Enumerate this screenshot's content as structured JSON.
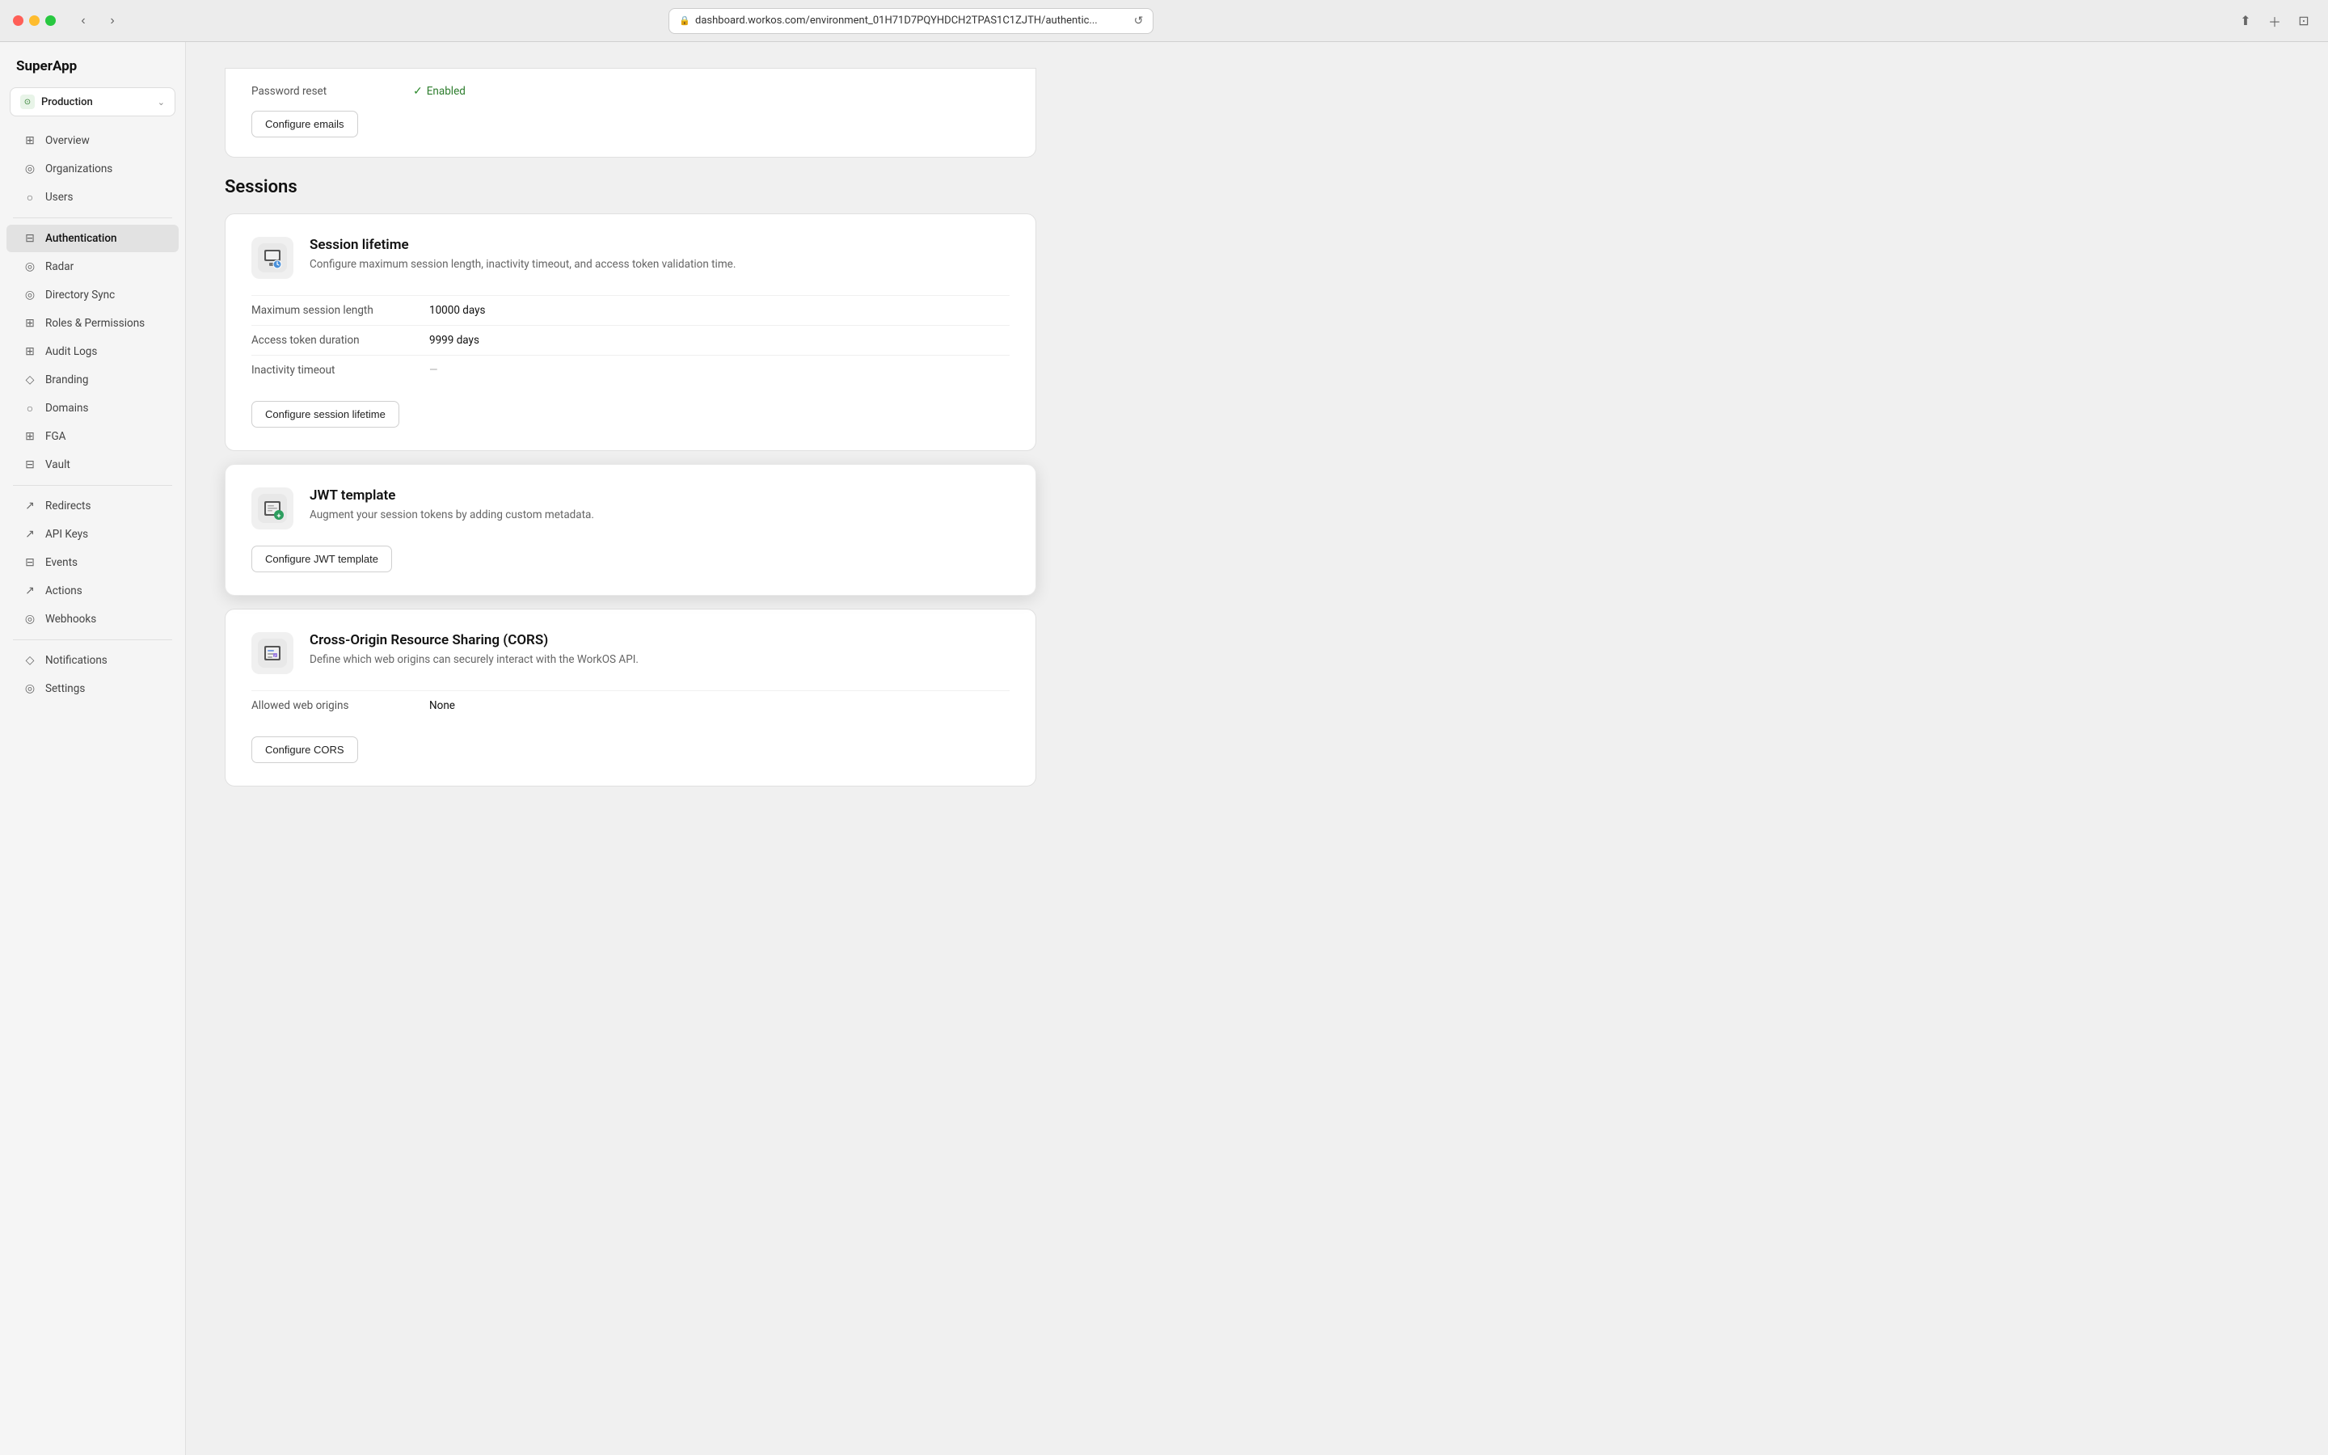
{
  "browser": {
    "url": "dashboard.workos.com/environment_01H71D7PQYHDCH2TPAS1C1ZJTH/authentic...",
    "back_label": "‹",
    "forward_label": "›"
  },
  "app": {
    "logo": "SuperApp"
  },
  "env_selector": {
    "label": "Production",
    "chevron": "⌄"
  },
  "sidebar": {
    "items": [
      {
        "id": "overview",
        "label": "Overview",
        "icon": "⊞"
      },
      {
        "id": "organizations",
        "label": "Organizations",
        "icon": "◎"
      },
      {
        "id": "users",
        "label": "Users",
        "icon": "○"
      },
      {
        "id": "authentication",
        "label": "Authentication",
        "icon": "⊟",
        "active": true
      },
      {
        "id": "radar",
        "label": "Radar",
        "icon": "◎"
      },
      {
        "id": "directory-sync",
        "label": "Directory Sync",
        "icon": "◎"
      },
      {
        "id": "roles-permissions",
        "label": "Roles & Permissions",
        "icon": "⊞"
      },
      {
        "id": "audit-logs",
        "label": "Audit Logs",
        "icon": "⊞"
      },
      {
        "id": "branding",
        "label": "Branding",
        "icon": "◇"
      },
      {
        "id": "domains",
        "label": "Domains",
        "icon": "○"
      },
      {
        "id": "fga",
        "label": "FGA",
        "icon": "⊞"
      },
      {
        "id": "vault",
        "label": "Vault",
        "icon": "⊟"
      },
      {
        "id": "redirects",
        "label": "Redirects",
        "icon": "↗"
      },
      {
        "id": "api-keys",
        "label": "API Keys",
        "icon": "↗"
      },
      {
        "id": "events",
        "label": "Events",
        "icon": "⊟"
      },
      {
        "id": "actions",
        "label": "Actions",
        "icon": "↗"
      },
      {
        "id": "webhooks",
        "label": "Webhooks",
        "icon": "◎"
      },
      {
        "id": "notifications",
        "label": "Notifications",
        "icon": "◇"
      },
      {
        "id": "settings",
        "label": "Settings",
        "icon": "◎"
      }
    ]
  },
  "top_card": {
    "label": "Password reset",
    "status": "Enabled",
    "configure_btn": "Configure emails"
  },
  "sessions_section": {
    "title": "Sessions"
  },
  "session_lifetime_card": {
    "title": "Session lifetime",
    "description": "Configure maximum session length, inactivity timeout, and access token validation time.",
    "fields": [
      {
        "label": "Maximum session length",
        "value": "10000 days"
      },
      {
        "label": "Access token duration",
        "value": "9999 days"
      },
      {
        "label": "Inactivity timeout",
        "value": "—"
      }
    ],
    "configure_btn": "Configure session lifetime"
  },
  "jwt_template_card": {
    "title": "JWT template",
    "description": "Augment your session tokens by adding custom metadata.",
    "configure_btn": "Configure JWT template"
  },
  "cors_card": {
    "title": "Cross-Origin Resource Sharing (CORS)",
    "description": "Define which web origins can securely interact with the WorkOS API.",
    "fields": [
      {
        "label": "Allowed web origins",
        "value": "None"
      }
    ],
    "configure_btn": "Configure CORS"
  }
}
